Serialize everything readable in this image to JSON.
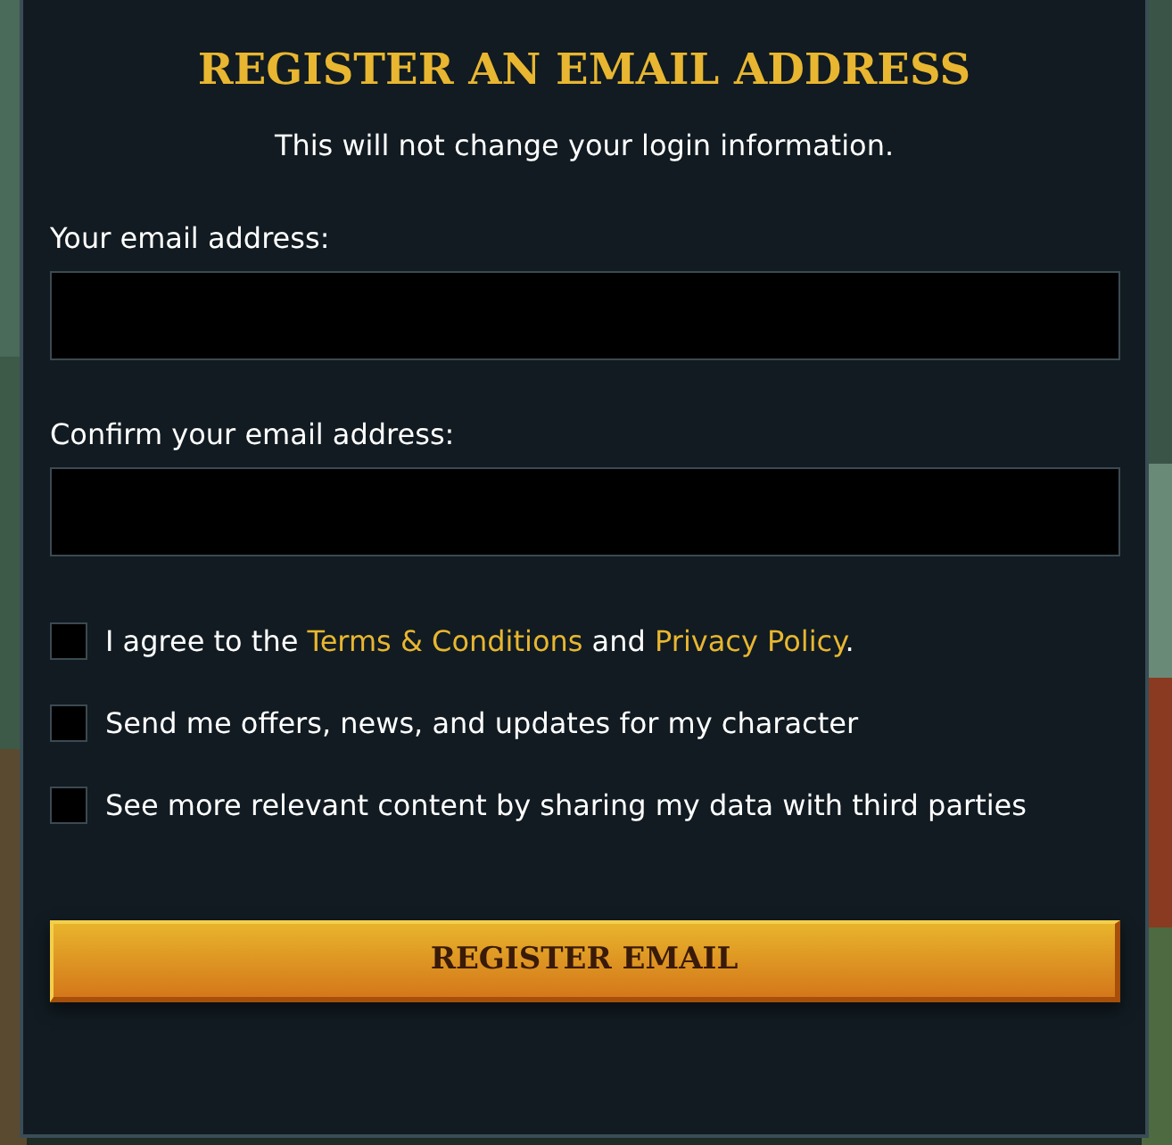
{
  "title": "REGISTER AN EMAIL ADDRESS",
  "subtitle": "This will not change your login information.",
  "fields": [
    {
      "label": "Your email address:"
    },
    {
      "label": "Confirm your email address:"
    }
  ],
  "checkboxes": [
    {
      "checked": false,
      "parts": [
        {
          "kind": "text",
          "text": "I agree to the "
        },
        {
          "kind": "link",
          "text": "Terms & Conditions"
        },
        {
          "kind": "text",
          "text": " and "
        },
        {
          "kind": "link",
          "text": "Privacy Policy"
        },
        {
          "kind": "text",
          "text": "."
        }
      ]
    },
    {
      "checked": false,
      "parts": [
        {
          "kind": "text",
          "text": "Send me offers, news, and updates for my character"
        }
      ]
    },
    {
      "checked": false,
      "parts": [
        {
          "kind": "text",
          "text": "See more relevant content by sharing my data with third parties"
        }
      ]
    }
  ],
  "button": "REGISTER EMAIL"
}
